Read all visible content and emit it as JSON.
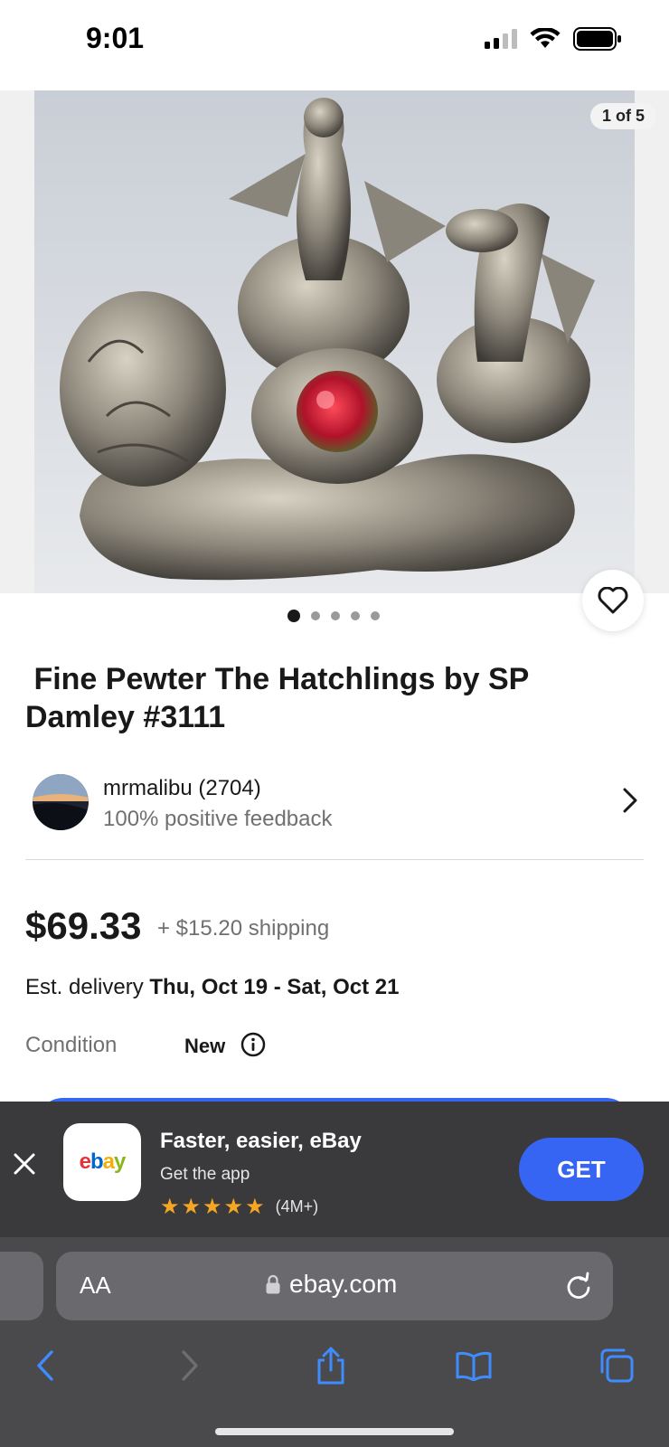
{
  "status": {
    "time": "9:01"
  },
  "gallery": {
    "counter": "1 of 5",
    "dot_count": 5,
    "active_dot": 0
  },
  "listing": {
    "title": " Fine Pewter The Hatchlings by SP Damley #3111",
    "price": "$69.33",
    "shipping": "+ $15.20 shipping",
    "delivery_prefix": "Est. delivery",
    "delivery_dates": "Thu, Oct 19 - Sat, Oct 21",
    "condition_label": "Condition",
    "condition_value": "New"
  },
  "seller": {
    "name": "mrmalibu (2704)",
    "feedback": "100% positive feedback"
  },
  "app_banner": {
    "title": "Faster, easier, eBay",
    "subtitle": "Get the app",
    "rating_stars": 5,
    "rating_count": "(4M+)",
    "get_label": "GET",
    "logo_text": "ebay"
  },
  "safari": {
    "aa_label": "AA",
    "url": "ebay.com"
  },
  "colors": {
    "accent": "#3665f3",
    "star": "#f5a623",
    "banner_bg": "#3a3a3c",
    "safari_bg": "#4a4a4c"
  },
  "icons": [
    "signal-icon",
    "wifi-icon",
    "battery-icon",
    "heart-icon",
    "chevron-right-icon",
    "info-icon",
    "close-icon",
    "star-icon",
    "lock-icon",
    "reload-icon",
    "back-icon",
    "forward-icon",
    "share-icon",
    "bookmarks-icon",
    "tabs-icon"
  ]
}
